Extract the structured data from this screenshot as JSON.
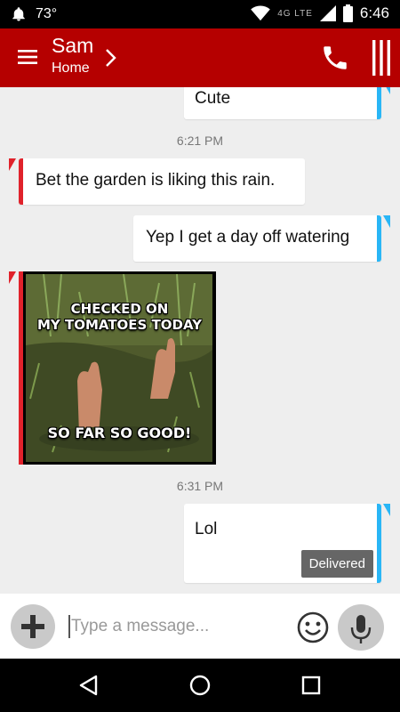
{
  "status": {
    "temperature": "73°",
    "network": "4G LTE",
    "time": "6:46"
  },
  "header": {
    "contact_name": "Sam",
    "contact_sub": "Home"
  },
  "messages": [
    {
      "direction": "out",
      "text": "Cute"
    },
    {
      "timestamp": "6:21 PM"
    },
    {
      "direction": "in",
      "text": "Bet the garden is liking this rain."
    },
    {
      "direction": "out",
      "text": "Yep I get a day off watering"
    },
    {
      "direction": "in",
      "type": "image",
      "caption_top": "CHECKED ON\nMY TOMATOES TODAY",
      "caption_bottom": "SO FAR SO GOOD!"
    },
    {
      "timestamp": "6:31 PM"
    },
    {
      "direction": "out",
      "text": "Lol",
      "status": "Delivered"
    }
  ],
  "composer": {
    "placeholder": "Type a message..."
  },
  "colors": {
    "header": "#b50000",
    "outgoing_accent": "#29b6f6",
    "incoming_accent": "#e0222b",
    "background": "#eeeeee"
  },
  "icons": [
    "bell-icon",
    "wifi-icon",
    "signal-icon",
    "battery-icon",
    "menu-icon",
    "chevron-right-icon",
    "phone-icon",
    "more-bars-icon",
    "plus-icon",
    "emoji-icon",
    "mic-icon",
    "back-icon",
    "home-icon",
    "recents-icon"
  ]
}
